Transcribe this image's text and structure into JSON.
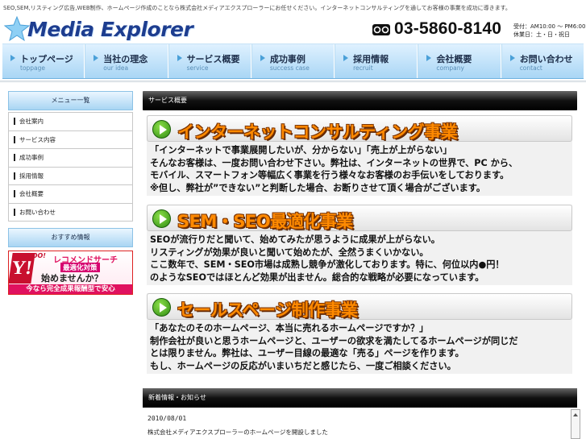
{
  "header": {
    "tagline": "SEO,SEM,リスティング広告,WEB制作、ホームページ作成のことなら株式会社メディアエクスプローラーにお任せください。インターネットコンサルティングを通してお客様の事業を成功に導きます。",
    "logo_text": "Media Explorer",
    "phone": "03-5860-8140",
    "hours_line1": "受付：AM10:00 〜 PM6:00",
    "hours_line2": "休業日：土・日・祝日"
  },
  "nav": [
    {
      "label": "トップページ",
      "sub": "toppage"
    },
    {
      "label": "当社の理念",
      "sub": "our idea"
    },
    {
      "label": "サービス概要",
      "sub": "service"
    },
    {
      "label": "成功事例",
      "sub": "success case"
    },
    {
      "label": "採用情報",
      "sub": "recruit"
    },
    {
      "label": "会社概要",
      "sub": "company"
    },
    {
      "label": "お問い合わせ",
      "sub": "contact"
    }
  ],
  "sidebar": {
    "heading": "メニュー一覧",
    "items": [
      "会社案内",
      "サービス内容",
      "成功事例",
      "採用情報",
      "会社概要",
      "お問い合わせ"
    ],
    "heading2": "おすすめ情報",
    "banner": {
      "brand_big": "Y!",
      "brand_small": "HOO!",
      "line1": "レコメンドサーチ",
      "line2": "最適化対策",
      "line3": "始めませんか？",
      "line4": "今なら完全成果報酬型で安心"
    }
  },
  "main": {
    "heading": "サービス概要",
    "services": [
      {
        "title": "インターネットコンサルティング事業",
        "body": [
          "「インターネットで事業展開したいが、分からない」「売上が上がらない」",
          "そんなお客様は、一度お問い合わせ下さい。弊社は、インターネットの世界で、PC から、",
          "モバイル、スマートフォン等幅広く事業を行う様々なお客様のお手伝いをしております。",
          "※但し、弊社が”できない”と判断した場合、お断りさせて頂く場合がございます。"
        ]
      },
      {
        "title": "SEM・SEO最適化事業",
        "body": [
          "SEOが流行りだと聞いて、始めてみたが思うように成果が上がらない。",
          "リスティングが効果が良いと聞いて始めたが、全然うまくいかない。",
          "ここ数年で、SEM・SEO市場は成熟し競争が激化しております。特に、何位以内●円！",
          "のようなSEOではほとんど効果が出ません。総合的な戦略が必要になっています。"
        ]
      },
      {
        "title": "セールスページ制作事業",
        "body": [
          "「あなたのそのホームページ、本当に売れるホームページですか？」",
          "制作会社が良いと思うホームページと、ユーザーの欲求を満たしてるホームページが同じだ",
          "とは限りません。弊社は、ユーザー目線の最適な「売る」ページを作ります。",
          "もし、ホームページの反応がいまいちだと感じたら、一度ご相談ください。"
        ]
      }
    ]
  },
  "news": {
    "heading": "新着情報・お知らせ",
    "date": "2010/08/01",
    "text": "株式会社メディアエクスプローラーのホームページを開設しました"
  },
  "colors": {
    "accent_orange": "#ff8a00",
    "nav_blue": "#a9d6f5",
    "logo_blue": "#1d3d8f"
  }
}
